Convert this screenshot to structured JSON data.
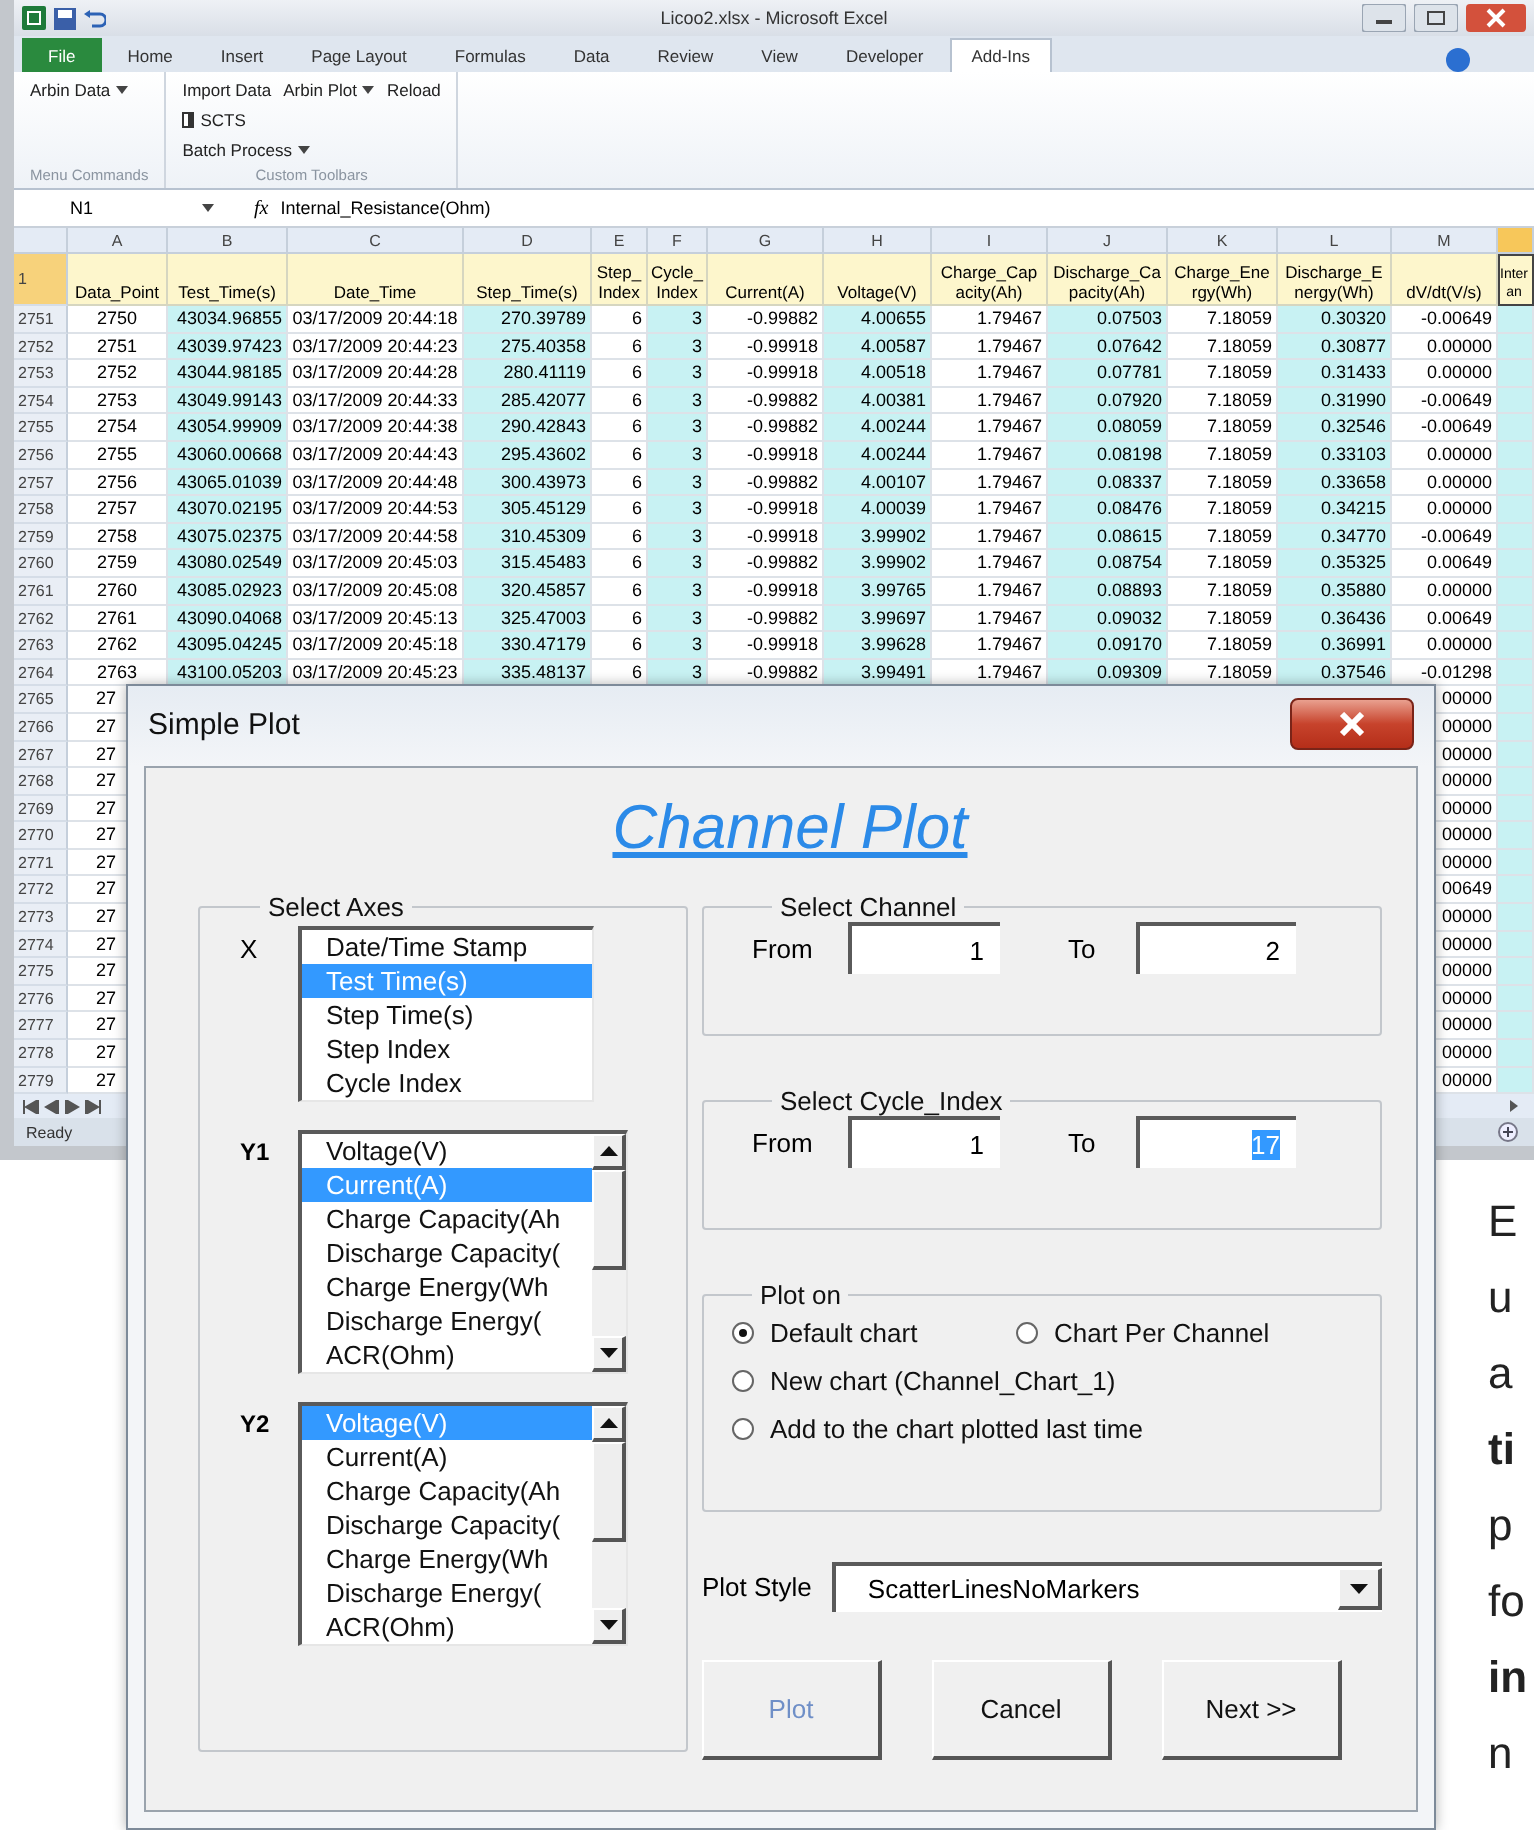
{
  "window": {
    "title": "Licoo2.xlsx - Microsoft Excel"
  },
  "ribbon": {
    "tabs": [
      {
        "label": "File",
        "kind": "file",
        "selected": false
      },
      {
        "label": "Home",
        "kind": "tab",
        "selected": false
      },
      {
        "label": "Insert",
        "kind": "tab",
        "selected": false
      },
      {
        "label": "Page Layout",
        "kind": "tab",
        "selected": false
      },
      {
        "label": "Formulas",
        "kind": "tab",
        "selected": false
      },
      {
        "label": "Data",
        "kind": "tab",
        "selected": false
      },
      {
        "label": "Review",
        "kind": "tab",
        "selected": false
      },
      {
        "label": "View",
        "kind": "tab",
        "selected": false
      },
      {
        "label": "Developer",
        "kind": "tab",
        "selected": false
      },
      {
        "label": "Add-Ins",
        "kind": "tab",
        "selected": true
      }
    ],
    "groups": [
      {
        "label": "Menu Commands",
        "rows": [
          [
            {
              "label": "Arbin Data",
              "dropdown": true,
              "icon": false
            }
          ]
        ]
      },
      {
        "label": "Custom Toolbars",
        "rows": [
          [
            {
              "label": "Import Data",
              "dropdown": false,
              "icon": false
            },
            {
              "label": "Arbin Plot",
              "dropdown": true,
              "icon": false
            },
            {
              "label": "Reload",
              "dropdown": false,
              "icon": false
            }
          ],
          [
            {
              "label": "SCTS",
              "dropdown": false,
              "icon": true
            }
          ],
          [
            {
              "label": "Batch Process",
              "dropdown": true,
              "icon": false
            }
          ]
        ]
      }
    ]
  },
  "formula_bar": {
    "name_box": "N1",
    "function_label": "fx",
    "content": "Internal_Resistance(Ohm)"
  },
  "sheet": {
    "header_row_number": "1",
    "columns": [
      {
        "letter": "A",
        "header": "Data_Point",
        "shaded": false,
        "selected": false
      },
      {
        "letter": "B",
        "header": "Test_Time(s)",
        "shaded": true,
        "selected": false
      },
      {
        "letter": "C",
        "header": "Date_Time",
        "shaded": false,
        "selected": false
      },
      {
        "letter": "D",
        "header": "Step_Time(s)",
        "shaded": true,
        "selected": false
      },
      {
        "letter": "E",
        "header": "Step_\nIndex",
        "shaded": false,
        "selected": false
      },
      {
        "letter": "F",
        "header": "Cycle_\nIndex",
        "shaded": true,
        "selected": false
      },
      {
        "letter": "G",
        "header": "Current(A)",
        "shaded": false,
        "selected": false
      },
      {
        "letter": "H",
        "header": "Voltage(V)",
        "shaded": true,
        "selected": false
      },
      {
        "letter": "I",
        "header": "Charge_Cap\nacity(Ah)",
        "shaded": false,
        "selected": false
      },
      {
        "letter": "J",
        "header": "Discharge_Ca\npacity(Ah)",
        "shaded": true,
        "selected": false
      },
      {
        "letter": "K",
        "header": "Charge_Ene\nrgy(Wh)",
        "shaded": false,
        "selected": false
      },
      {
        "letter": "L",
        "header": "Discharge_E\nnergy(Wh)",
        "shaded": true,
        "selected": false
      },
      {
        "letter": "M",
        "header": "dV/dt(V/s)",
        "shaded": false,
        "selected": false
      },
      {
        "header": "Inter\nan",
        "shaded": true,
        "selected": true
      }
    ],
    "rows": [
      {
        "number": "2751",
        "kind": "full",
        "cells": [
          "2750",
          "43034.96855",
          "03/17/2009 20:44:18",
          "270.39789",
          "6",
          "3",
          "-0.99882",
          "4.00655",
          "1.79467",
          "0.07503",
          "7.18059",
          "0.30320",
          "-0.00649"
        ]
      },
      {
        "number": "2752",
        "kind": "full",
        "cells": [
          "2751",
          "43039.97423",
          "03/17/2009 20:44:23",
          "275.40358",
          "6",
          "3",
          "-0.99918",
          "4.00587",
          "1.79467",
          "0.07642",
          "7.18059",
          "0.30877",
          "0.00000"
        ]
      },
      {
        "number": "2753",
        "kind": "full",
        "cells": [
          "2752",
          "43044.98185",
          "03/17/2009 20:44:28",
          "280.41119",
          "6",
          "3",
          "-0.99918",
          "4.00518",
          "1.79467",
          "0.07781",
          "7.18059",
          "0.31433",
          "0.00000"
        ]
      },
      {
        "number": "2754",
        "kind": "full",
        "cells": [
          "2753",
          "43049.99143",
          "03/17/2009 20:44:33",
          "285.42077",
          "6",
          "3",
          "-0.99882",
          "4.00381",
          "1.79467",
          "0.07920",
          "7.18059",
          "0.31990",
          "-0.00649"
        ]
      },
      {
        "number": "2755",
        "kind": "full",
        "cells": [
          "2754",
          "43054.99909",
          "03/17/2009 20:44:38",
          "290.42843",
          "6",
          "3",
          "-0.99882",
          "4.00244",
          "1.79467",
          "0.08059",
          "7.18059",
          "0.32546",
          "-0.00649"
        ]
      },
      {
        "number": "2756",
        "kind": "full",
        "cells": [
          "2755",
          "43060.00668",
          "03/17/2009 20:44:43",
          "295.43602",
          "6",
          "3",
          "-0.99918",
          "4.00244",
          "1.79467",
          "0.08198",
          "7.18059",
          "0.33103",
          "0.00000"
        ]
      },
      {
        "number": "2757",
        "kind": "full",
        "cells": [
          "2756",
          "43065.01039",
          "03/17/2009 20:44:48",
          "300.43973",
          "6",
          "3",
          "-0.99882",
          "4.00107",
          "1.79467",
          "0.08337",
          "7.18059",
          "0.33658",
          "0.00000"
        ]
      },
      {
        "number": "2758",
        "kind": "full",
        "cells": [
          "2757",
          "43070.02195",
          "03/17/2009 20:44:53",
          "305.45129",
          "6",
          "3",
          "-0.99918",
          "4.00039",
          "1.79467",
          "0.08476",
          "7.18059",
          "0.34215",
          "0.00000"
        ]
      },
      {
        "number": "2759",
        "kind": "full",
        "cells": [
          "2758",
          "43075.02375",
          "03/17/2009 20:44:58",
          "310.45309",
          "6",
          "3",
          "-0.99918",
          "3.99902",
          "1.79467",
          "0.08615",
          "7.18059",
          "0.34770",
          "-0.00649"
        ]
      },
      {
        "number": "2760",
        "kind": "full",
        "cells": [
          "2759",
          "43080.02549",
          "03/17/2009 20:45:03",
          "315.45483",
          "6",
          "3",
          "-0.99882",
          "3.99902",
          "1.79467",
          "0.08754",
          "7.18059",
          "0.35325",
          "0.00649"
        ]
      },
      {
        "number": "2761",
        "kind": "full",
        "cells": [
          "2760",
          "43085.02923",
          "03/17/2009 20:45:08",
          "320.45857",
          "6",
          "3",
          "-0.99918",
          "3.99765",
          "1.79467",
          "0.08893",
          "7.18059",
          "0.35880",
          "0.00000"
        ]
      },
      {
        "number": "2762",
        "kind": "full",
        "cells": [
          "2761",
          "43090.04068",
          "03/17/2009 20:45:13",
          "325.47003",
          "6",
          "3",
          "-0.99882",
          "3.99697",
          "1.79467",
          "0.09032",
          "7.18059",
          "0.36436",
          "0.00649"
        ]
      },
      {
        "number": "2763",
        "kind": "full",
        "cells": [
          "2762",
          "43095.04245",
          "03/17/2009 20:45:18",
          "330.47179",
          "6",
          "3",
          "-0.99918",
          "3.99628",
          "1.79467",
          "0.09170",
          "7.18059",
          "0.36991",
          "0.00000"
        ]
      },
      {
        "number": "2764",
        "kind": "full",
        "cells": [
          "2763",
          "43100.05203",
          "03/17/2009 20:45:23",
          "335.48137",
          "6",
          "3",
          "-0.99882",
          "3.99491",
          "1.79467",
          "0.09309",
          "7.18059",
          "0.37546",
          "-0.01298"
        ]
      },
      {
        "number": "2765",
        "kind": "covered",
        "cells": [
          "27",
          "00000"
        ]
      },
      {
        "number": "2766",
        "kind": "covered",
        "cells": [
          "27",
          "00000"
        ]
      },
      {
        "number": "2767",
        "kind": "covered",
        "cells": [
          "27",
          "00000"
        ]
      },
      {
        "number": "2768",
        "kind": "covered",
        "cells": [
          "27",
          "00000"
        ]
      },
      {
        "number": "2769",
        "kind": "covered",
        "cells": [
          "27",
          "00000"
        ]
      },
      {
        "number": "2770",
        "kind": "covered",
        "cells": [
          "27",
          "00000"
        ]
      },
      {
        "number": "2771",
        "kind": "covered",
        "cells": [
          "27",
          "00000"
        ]
      },
      {
        "number": "2772",
        "kind": "covered",
        "cells": [
          "27",
          "00649"
        ]
      },
      {
        "number": "2773",
        "kind": "covered",
        "cells": [
          "27",
          "00000"
        ]
      },
      {
        "number": "2774",
        "kind": "covered",
        "cells": [
          "27",
          "00000"
        ]
      },
      {
        "number": "2775",
        "kind": "covered",
        "cells": [
          "27",
          "00000"
        ]
      },
      {
        "number": "2776",
        "kind": "covered",
        "cells": [
          "27",
          "00000"
        ]
      },
      {
        "number": "2777",
        "kind": "covered",
        "cells": [
          "27",
          "00000"
        ]
      },
      {
        "number": "2778",
        "kind": "covered",
        "cells": [
          "27",
          "00000"
        ]
      },
      {
        "number": "2779",
        "kind": "covered",
        "cells": [
          "27",
          "00000"
        ]
      }
    ],
    "status": "Ready"
  },
  "dialog": {
    "title": "Simple Plot",
    "heading": "Channel Plot",
    "axes": {
      "title": "Select Axes",
      "lists": [
        {
          "label": "X",
          "scrollbar": false,
          "items": [
            {
              "label": "Date/Time Stamp",
              "selected": false
            },
            {
              "label": "Test Time(s)",
              "selected": true
            },
            {
              "label": "Step Time(s)",
              "selected": false
            },
            {
              "label": "Step Index",
              "selected": false
            },
            {
              "label": "Cycle Index",
              "selected": false
            }
          ]
        },
        {
          "label": "Y1",
          "scrollbar": true,
          "items": [
            {
              "label": "Voltage(V)",
              "selected": false
            },
            {
              "label": "Current(A)",
              "selected": true
            },
            {
              "label": "Charge Capacity(Ah",
              "selected": false
            },
            {
              "label": "Discharge Capacity(",
              "selected": false
            },
            {
              "label": "Charge Energy(Wh",
              "selected": false
            },
            {
              "label": "Discharge Energy(",
              "selected": false
            },
            {
              "label": "ACR(Ohm)",
              "selected": false
            }
          ]
        },
        {
          "label": "Y2",
          "scrollbar": true,
          "items": [
            {
              "label": "Voltage(V)",
              "selected": true
            },
            {
              "label": "Current(A)",
              "selected": false
            },
            {
              "label": "Charge Capacity(Ah",
              "selected": false
            },
            {
              "label": "Discharge Capacity(",
              "selected": false
            },
            {
              "label": "Charge Energy(Wh",
              "selected": false
            },
            {
              "label": "Discharge Energy(",
              "selected": false
            },
            {
              "label": "ACR(Ohm)",
              "selected": false
            }
          ]
        }
      ]
    },
    "ranges": [
      {
        "title": "Select Channel",
        "fields": [
          {
            "label": "From",
            "value": "1",
            "text_selected": false
          },
          {
            "label": "To",
            "value": "2",
            "text_selected": false
          }
        ]
      },
      {
        "title": "Select Cycle_Index",
        "fields": [
          {
            "label": "From",
            "value": "1",
            "text_selected": false
          },
          {
            "label": "To",
            "value": "17",
            "text_selected": true
          }
        ]
      }
    ],
    "plot_on": {
      "title": "Plot on",
      "options": [
        {
          "label": "Default chart",
          "selected": true
        },
        {
          "label": "Chart Per Channel",
          "selected": false
        },
        {
          "label": "New chart (Channel_Chart_1)",
          "selected": false
        },
        {
          "label": "Add to the chart plotted last time",
          "selected": false
        }
      ]
    },
    "plot_style": {
      "label": "Plot Style",
      "value": "ScatterLinesNoMarkers"
    },
    "buttons": [
      {
        "label": "Plot",
        "disabled": true
      },
      {
        "label": "Cancel",
        "disabled": false
      },
      {
        "label": "Next >>",
        "disabled": false
      }
    ]
  },
  "page_text": [
    {
      "text": "E",
      "bold": false
    },
    {
      "text": "u",
      "bold": false
    },
    {
      "text": "a",
      "bold": false
    },
    {
      "text": "ti",
      "bold": true
    },
    {
      "text": "p",
      "bold": false
    },
    {
      "text": "fo",
      "bold": false
    },
    {
      "text": "in",
      "bold": true
    },
    {
      "text": "n",
      "bold": false
    }
  ]
}
